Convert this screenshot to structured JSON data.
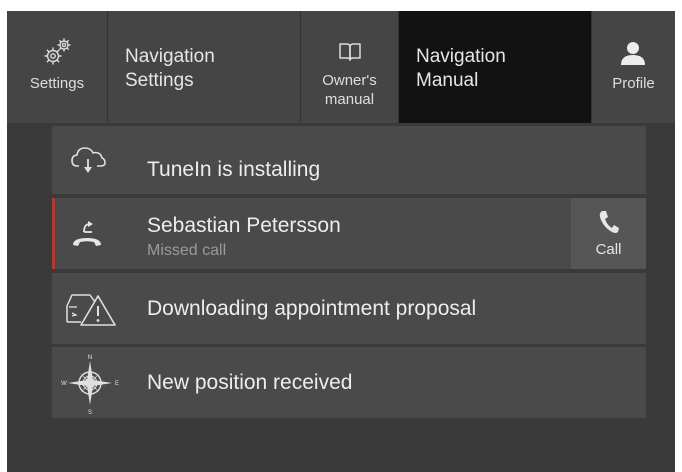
{
  "topbar": {
    "settings_label": "Settings",
    "nav_settings_label": "Navigation\nSettings",
    "owners_manual_label": "Owner's\nmanual",
    "nav_manual_label": "Navigation\nManual",
    "profile_label": "Profile"
  },
  "notifications": [
    {
      "title": "TuneIn is installing",
      "icon": "cloud-download-icon"
    },
    {
      "title": "Sebastian Petersson",
      "subtitle": "Missed call",
      "icon": "missed-call-icon",
      "action_label": "Call",
      "accent_color": "#b03a2e"
    },
    {
      "title": "Downloading appointment proposal",
      "icon": "car-warning-icon"
    },
    {
      "title": "New position received",
      "icon": "compass-rose-icon",
      "compass": {
        "n": "N",
        "s": "S",
        "e": "E",
        "w": "W"
      }
    }
  ],
  "colors": {
    "background": "#3a3a3a",
    "topbar": "#454545",
    "active_tab": "#121212",
    "card": "#4a4a4a"
  }
}
